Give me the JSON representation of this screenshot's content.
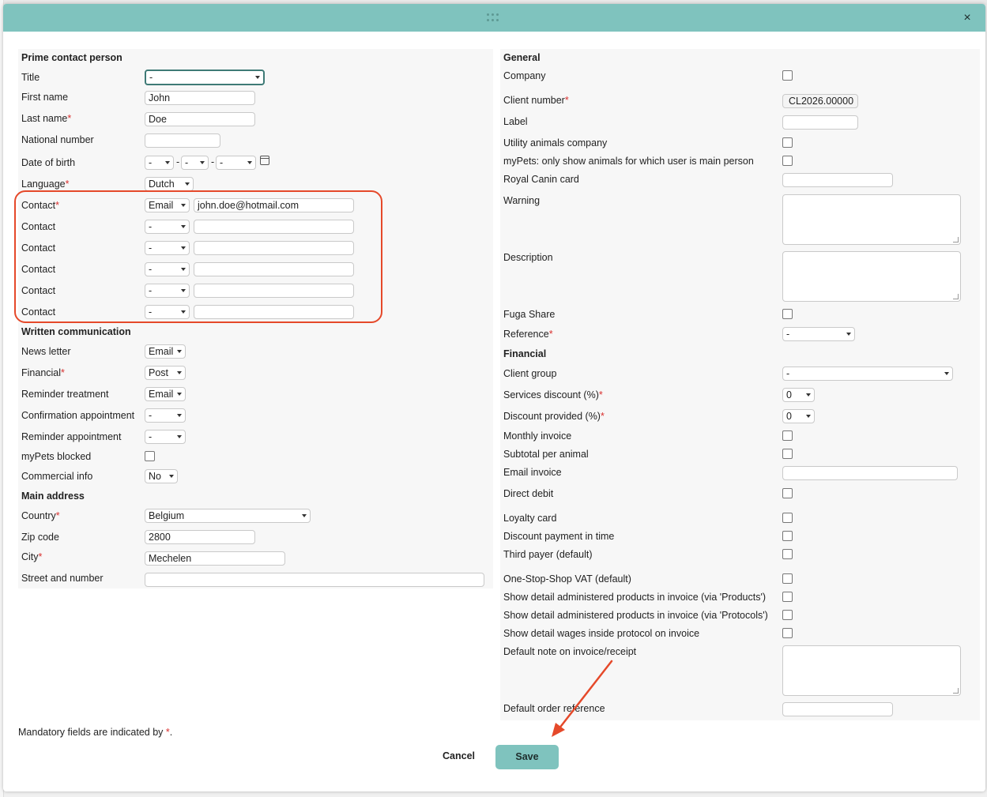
{
  "dialog": {
    "close_label": "×"
  },
  "prime": {
    "header": "Prime contact person",
    "title_label": "Title",
    "title_value": "-",
    "first_name_label": "First name",
    "first_name_value": "John",
    "last_name_label": "Last name",
    "last_name_value": "Doe",
    "national_number_label": "National number",
    "dob_label": "Date of birth",
    "dob_day": "-",
    "dob_month": "-",
    "dob_year": "-",
    "dob_sep": "-",
    "language_label": "Language",
    "language_value": "Dutch",
    "contacts": [
      {
        "label": "Contact",
        "type": "Email",
        "value": "john.doe@hotmail.com"
      },
      {
        "label": "Contact",
        "type": "-",
        "value": ""
      },
      {
        "label": "Contact",
        "type": "-",
        "value": ""
      },
      {
        "label": "Contact",
        "type": "-",
        "value": ""
      },
      {
        "label": "Contact",
        "type": "-",
        "value": ""
      },
      {
        "label": "Contact",
        "type": "-",
        "value": ""
      }
    ]
  },
  "written": {
    "header": "Written communication",
    "newsletter_label": "News letter",
    "newsletter_value": "Email",
    "financial_label": "Financial",
    "financial_value": "Post",
    "reminder_treatment_label": "Reminder treatment",
    "reminder_treatment_value": "Email",
    "confirmation_appointment_label": "Confirmation appointment",
    "confirmation_appointment_value": "-",
    "reminder_appointment_label": "Reminder appointment",
    "reminder_appointment_value": "-",
    "mypets_blocked_label": "myPets blocked",
    "commercial_info_label": "Commercial info",
    "commercial_info_value": "No"
  },
  "address": {
    "header": "Main address",
    "country_label": "Country",
    "country_value": "Belgium",
    "zip_label": "Zip code",
    "zip_value": "2800",
    "city_label": "City",
    "city_value": "Mechelen",
    "street_label": "Street and number",
    "street_value": ""
  },
  "general": {
    "header": "General",
    "company_label": "Company",
    "client_number_label": "Client number",
    "client_number_value": "CL2026.00000",
    "label_label": "Label",
    "utility_label": "Utility animals company",
    "mypets_only_label": "myPets: only show animals for which user is main person",
    "royal_canin_label": "Royal Canin card",
    "warning_label": "Warning",
    "description_label": "Description",
    "fuga_label": "Fuga Share",
    "reference_label": "Reference",
    "reference_value": "-"
  },
  "financial": {
    "header": "Financial",
    "client_group_label": "Client group",
    "client_group_value": "-",
    "services_discount_label": "Services discount (%)",
    "services_discount_value": "0",
    "discount_provided_label": "Discount provided (%)",
    "discount_provided_value": "0",
    "monthly_invoice_label": "Monthly invoice",
    "subtotal_label": "Subtotal per animal",
    "email_invoice_label": "Email invoice",
    "direct_debit_label": "Direct debit",
    "loyalty_label": "Loyalty card",
    "discount_payment_label": "Discount payment in time",
    "third_payer_label": "Third payer (default)",
    "oss_label": "One-Stop-Shop VAT (default)",
    "detail_products_label": "Show detail administered products in invoice (via 'Products')",
    "detail_protocols_label": "Show detail administered products in invoice (via 'Protocols')",
    "detail_wages_label": "Show detail wages inside protocol on invoice",
    "default_note_label": "Default note on invoice/receipt",
    "default_order_label": "Default order reference"
  },
  "footer": {
    "mandatory_note": "Mandatory fields are indicated by ",
    "mandatory_star": "*",
    "mandatory_end": ".",
    "cancel_label": "Cancel",
    "save_label": "Save"
  },
  "colors": {
    "accent": "#7fc3be",
    "annotation": "#e5492a",
    "required": "#d9302f"
  },
  "icons": [
    "grip-icon",
    "close-icon",
    "calendar-icon",
    "chevron-down-icon",
    "annotation-arrow-icon"
  ]
}
